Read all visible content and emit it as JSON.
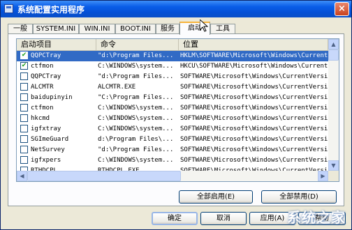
{
  "window": {
    "title": "系统配置实用程序",
    "close_label": "×"
  },
  "tabs": [
    "一般",
    "SYSTEM.INI",
    "WIN.INI",
    "BOOT.INI",
    "服务",
    "启动",
    "工具"
  ],
  "list": {
    "columns": [
      "启动项目",
      "命令",
      "位置"
    ],
    "rows": [
      {
        "checked": true,
        "item": "QQPCTray",
        "command": "\"d:\\Program Files...",
        "location": "HKLM\\SOFTWARE\\Microsoft\\Windows\\Current..."
      },
      {
        "checked": true,
        "item": "ctfmon",
        "command": "C:\\WINDOWS\\system...",
        "location": "HKCU\\SOFTWARE\\Microsoft\\Windows\\Current..."
      },
      {
        "checked": false,
        "item": "QQPCTray",
        "command": "\"d:\\Program Files...",
        "location": "SOFTWARE\\Microsoft\\Windows\\CurrentVersi..."
      },
      {
        "checked": false,
        "item": "ALCMTR",
        "command": "ALCMTR.EXE",
        "location": "SOFTWARE\\Microsoft\\Windows\\CurrentVersi..."
      },
      {
        "checked": false,
        "item": "baidupinyin",
        "command": "\"C:\\Program Files...",
        "location": "SOFTWARE\\Microsoft\\Windows\\CurrentVersi..."
      },
      {
        "checked": false,
        "item": "ctfmon",
        "command": "C:\\WINDOWS\\system...",
        "location": "SOFTWARE\\Microsoft\\Windows\\CurrentVersi..."
      },
      {
        "checked": false,
        "item": "hkcmd",
        "command": "C:\\WINDOWS\\system...",
        "location": "SOFTWARE\\Microsoft\\Windows\\CurrentVersi..."
      },
      {
        "checked": false,
        "item": "igfxtray",
        "command": "C:\\WINDOWS\\system...",
        "location": "SOFTWARE\\Microsoft\\Windows\\CurrentVersi..."
      },
      {
        "checked": false,
        "item": "SGImeGuard",
        "command": "d:\\Program Files\\...",
        "location": "SOFTWARE\\Microsoft\\Windows\\CurrentVersi..."
      },
      {
        "checked": false,
        "item": "NetSurvey",
        "command": "\"d:\\Program Files...",
        "location": "SOFTWARE\\Microsoft\\Windows\\CurrentVersi..."
      },
      {
        "checked": false,
        "item": "igfxpers",
        "command": "C:\\WINDOWS\\system...",
        "location": "SOFTWARE\\Microsoft\\Windows\\CurrentVersi..."
      },
      {
        "checked": false,
        "item": "RTHDCPL",
        "command": "RTHDCPL.EXE",
        "location": "SOFTWARE\\Microsoft\\Windows\\CurrentVersi..."
      }
    ]
  },
  "buttons": {
    "enable_all": "全部启用(E)",
    "disable_all": "全部禁用(D)",
    "ok": "确定",
    "cancel": "取消",
    "apply": "应用(A)",
    "help": "帮助"
  },
  "watermark": "系统之家",
  "colors": {
    "selection": "#316ac5",
    "titlebar": "#0a5ee8",
    "active_tab_accent": "#f7b33a"
  }
}
